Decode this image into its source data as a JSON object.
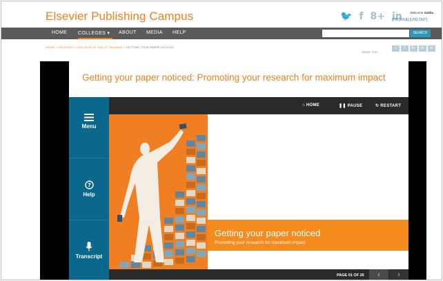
{
  "site": {
    "logo": "Elsevier Publishing Campus",
    "welcome_prefix": "Welcome",
    "welcome_name": "Gaella",
    "profile_links": "[PROFILE] [LOG OUT]",
    "social_icons": [
      "twitter-icon",
      "facebook-icon",
      "google-plus-icon",
      "linkedin-icon"
    ],
    "social_glyphs": [
      "🐦",
      "f",
      "8+",
      "in"
    ]
  },
  "nav": {
    "items": [
      "HOME",
      "COLLEGES",
      "ABOUT",
      "MEDIA",
      "HELP"
    ],
    "colleges_caret": "▾",
    "search_placeholder": "",
    "search_button": "SEARCH"
  },
  "breadcrumb": {
    "trail_orange": "HOME > COLLEGES > COLLEGE OF SKILLS TRAINING >",
    "current": "GETTING YOUR PAPER NOTICED",
    "share_label": "SHARE THIS:",
    "share_glyphs": [
      "t",
      "f",
      "8+",
      "in",
      "✉"
    ]
  },
  "player": {
    "course_title": "Getting your paper noticed: Promoting your research for maximum impact",
    "left_menu": {
      "menu_label": "Menu",
      "help_label": "Help",
      "transcript_label": "Transcript"
    },
    "toolbar": {
      "home_label": "HOME",
      "pause_label": "PAUSE",
      "restart_label": "RESTART"
    },
    "slide": {
      "title": "Getting your paper noticed",
      "subtitle": "Promoting your research for maximum impact"
    },
    "pager": {
      "label": "PAGE 01 OF 26",
      "prev": "‹",
      "next": "›"
    }
  },
  "colors": {
    "accent_orange": "#f07f1e",
    "panel_blue": "#0a688d",
    "nav_gray": "#5a5a5a",
    "search_blue": "#2e97b9"
  }
}
